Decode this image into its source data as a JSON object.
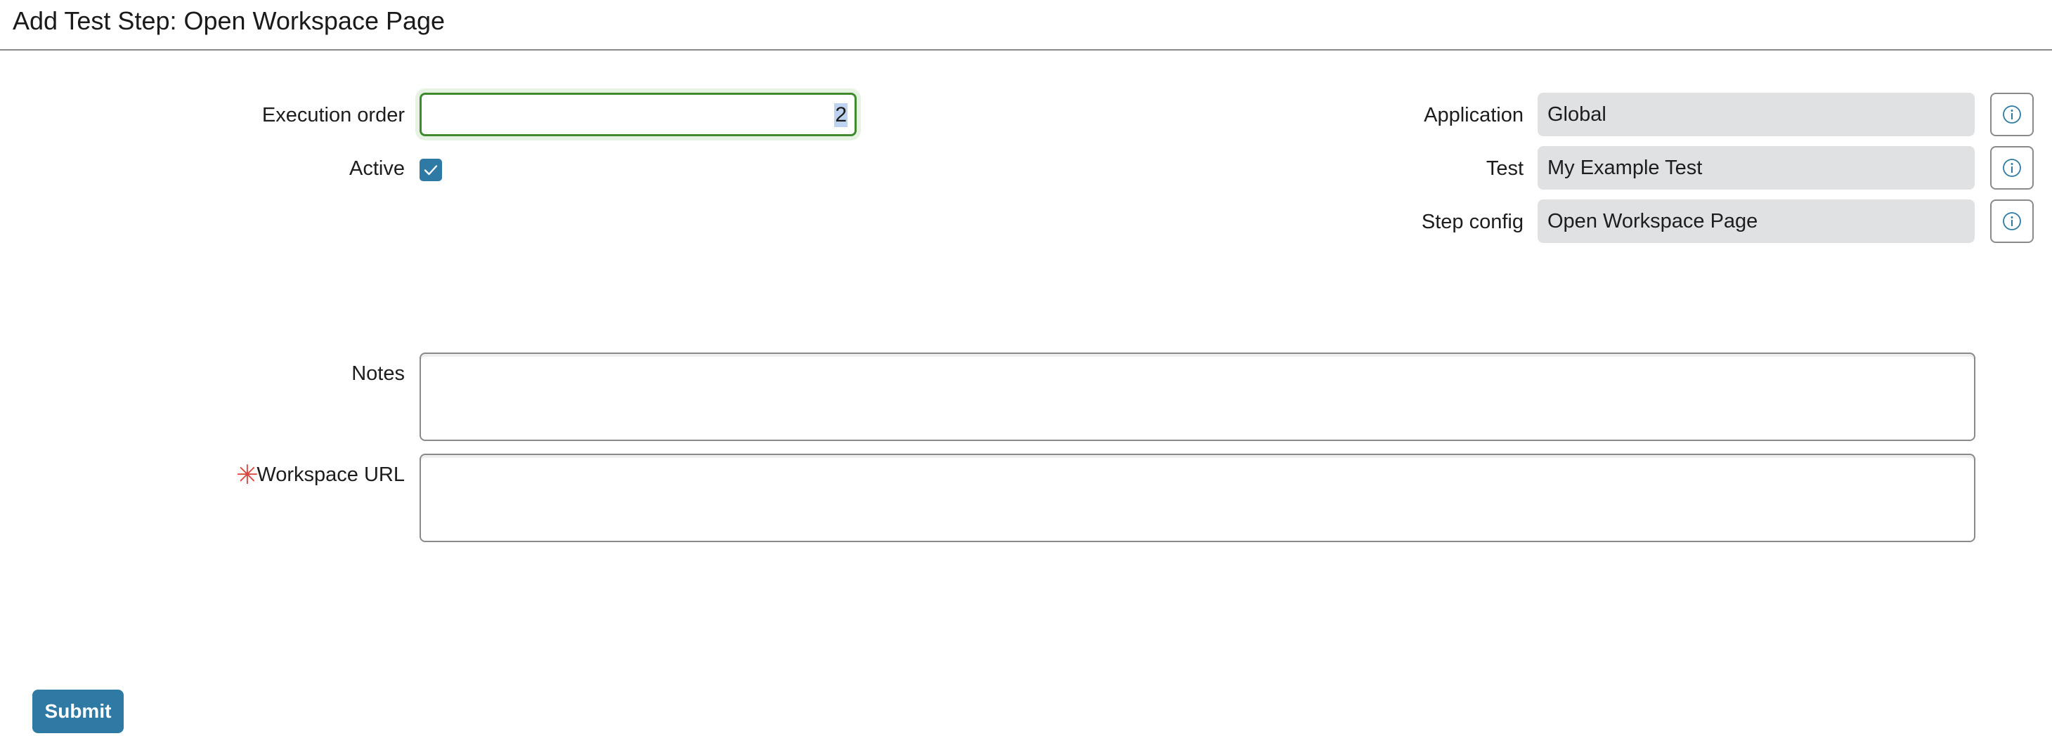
{
  "header": {
    "title": "Add Test Step: Open Workspace Page"
  },
  "form": {
    "execution_order": {
      "label": "Execution order",
      "value": "2"
    },
    "active": {
      "label": "Active",
      "checked": true
    },
    "application": {
      "label": "Application",
      "value": "Global"
    },
    "test": {
      "label": "Test",
      "value": "My Example Test"
    },
    "step_config": {
      "label": "Step config",
      "value": "Open Workspace Page"
    },
    "notes": {
      "label": "Notes",
      "value": ""
    },
    "workspace_url": {
      "label": "Workspace URL",
      "value": "",
      "required_marker": "✳"
    }
  },
  "actions": {
    "submit_label": "Submit"
  },
  "icons": {
    "info": "info-circle-icon",
    "check": "checkmark-icon"
  },
  "colors": {
    "primary": "#2e7aa5",
    "focus_border": "#3f8a2e",
    "required": "#d9473d",
    "readonly_bg": "#dfe1e3"
  }
}
